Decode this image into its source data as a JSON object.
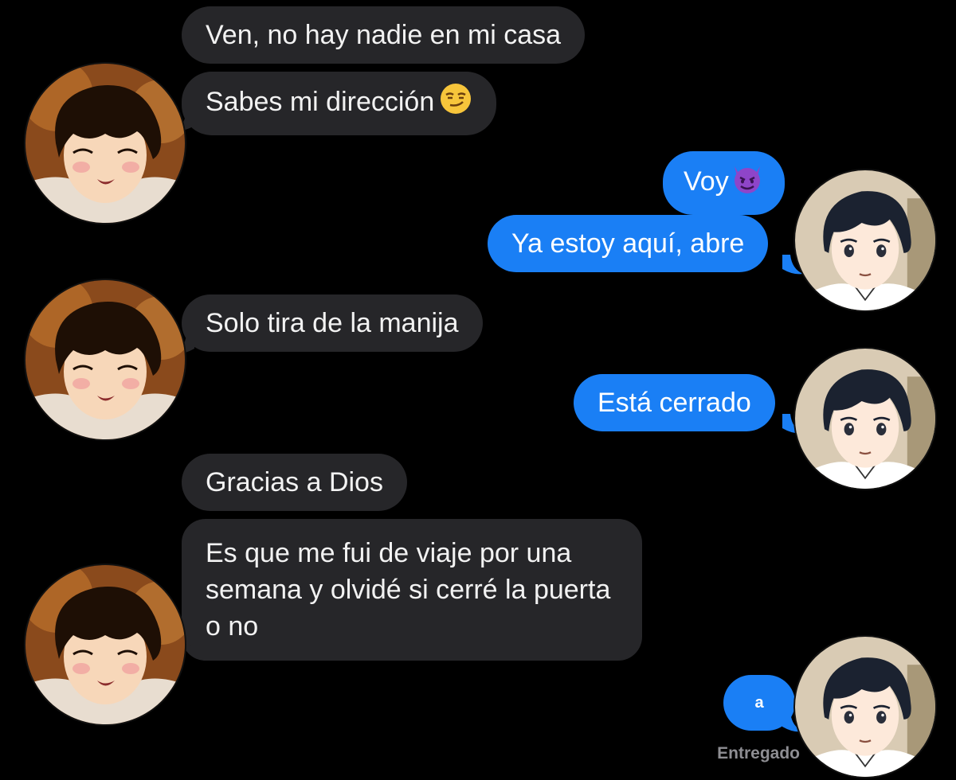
{
  "conversation": {
    "messages": [
      {
        "side": "incoming",
        "text": "Ven, no hay nadie en mi casa"
      },
      {
        "side": "incoming",
        "text": "Sabes mi dirección",
        "emoji": "smirking-face"
      },
      {
        "side": "outgoing",
        "text": "Voy",
        "emoji": "smiling-imp"
      },
      {
        "side": "outgoing",
        "text": "Ya estoy aquí, abre"
      },
      {
        "side": "incoming",
        "text": "Solo tira de la manija"
      },
      {
        "side": "outgoing",
        "text": "Está cerrado"
      },
      {
        "side": "incoming",
        "text": "Gracias a Dios"
      },
      {
        "side": "incoming",
        "text": "Es que me fui de viaje por una semana y olvidé si cerré la puerta o no"
      },
      {
        "side": "outgoing",
        "text": "a"
      }
    ],
    "delivery_status": "Entregado"
  },
  "avatars": {
    "contact": "anime-boy-blushing-avatar",
    "self": "anime-boy-black-hair-avatar"
  },
  "colors": {
    "background": "#000000",
    "incoming_bubble": "#262629",
    "outgoing_bubble": "#1a7ff5",
    "status_text": "#8e8e93"
  }
}
